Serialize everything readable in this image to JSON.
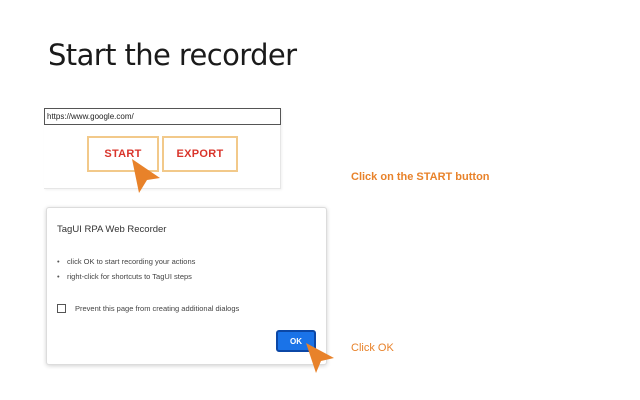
{
  "slide": {
    "title": "Start the recorder"
  },
  "recorder": {
    "url_value": "https://www.google.com/",
    "start_label": "START",
    "export_label": "EXPORT"
  },
  "dialog": {
    "title": "TagUI RPA Web Recorder",
    "bullets": [
      "click OK to start recording your actions",
      "right-click for shortcuts to TagUI steps"
    ],
    "prevent_label": "Prevent this page from creating additional dialogs",
    "ok_label": "OK"
  },
  "annotations": {
    "start_hint": "Click on the START button",
    "ok_hint": "Click OK",
    "accent_color": "#e8822a"
  },
  "icons": {
    "pointer": "pointer-arrow-icon",
    "bullet": "bullet-dot-icon",
    "checkbox": "checkbox-icon"
  },
  "colors": {
    "button_text": "#d9342b",
    "button_border": "#f2c98a",
    "ok_button": "#1a73e8"
  }
}
